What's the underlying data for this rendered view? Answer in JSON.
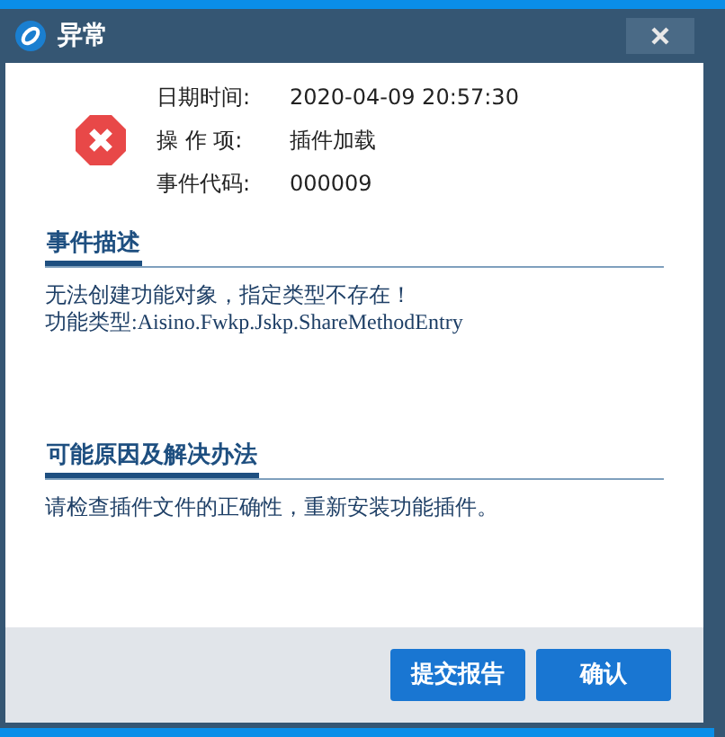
{
  "window": {
    "title": "异常"
  },
  "info": [
    {
      "label": "日期时间:",
      "value": "2020-04-09 20:57:30"
    },
    {
      "label": "操 作 项:",
      "value": "插件加载"
    },
    {
      "label": "事件代码:",
      "value": "000009"
    }
  ],
  "sections": [
    {
      "heading": "事件描述",
      "lines": [
        "无法创建功能对象，指定类型不存在！",
        "功能类型:Aisino.Fwkp.Jskp.ShareMethodEntry"
      ]
    },
    {
      "heading": "可能原因及解决办法",
      "lines": [
        "请检查插件文件的正确性，重新安装功能插件。"
      ]
    }
  ],
  "buttons": [
    "提交报告",
    "确认"
  ]
}
